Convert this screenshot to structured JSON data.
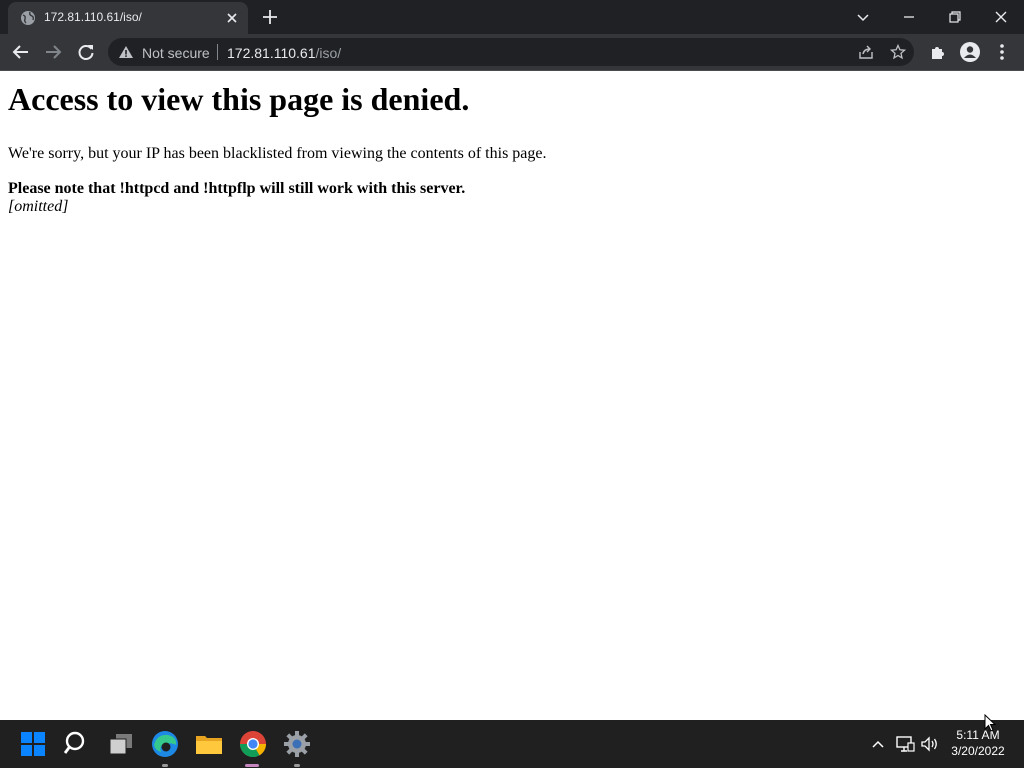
{
  "browser": {
    "tab": {
      "title": "172.81.110.61/iso/"
    },
    "address_bar": {
      "security_label": "Not secure",
      "url_host": "172.81.110.61",
      "url_path": "/iso/"
    }
  },
  "page": {
    "heading": "Access to view this page is denied.",
    "message": "We're sorry, but your IP has been blacklisted from viewing the contents of this page.",
    "note": "Please note that !httpcd and !httpflp will still work with this server.",
    "reason": "[omitted]"
  },
  "taskbar": {
    "apps": [
      "start-icon",
      "search-icon",
      "task-view-icon",
      "edge-icon",
      "file-explorer-icon",
      "chrome-icon",
      "settings-icon"
    ],
    "clock": {
      "time": "5:11 AM",
      "date": "3/20/2022"
    }
  },
  "colors": {
    "chrome_dark": "#202124",
    "chrome_toolbar": "#35363a",
    "taskbar": "#202020",
    "windows_blue": "#0a84ff"
  }
}
